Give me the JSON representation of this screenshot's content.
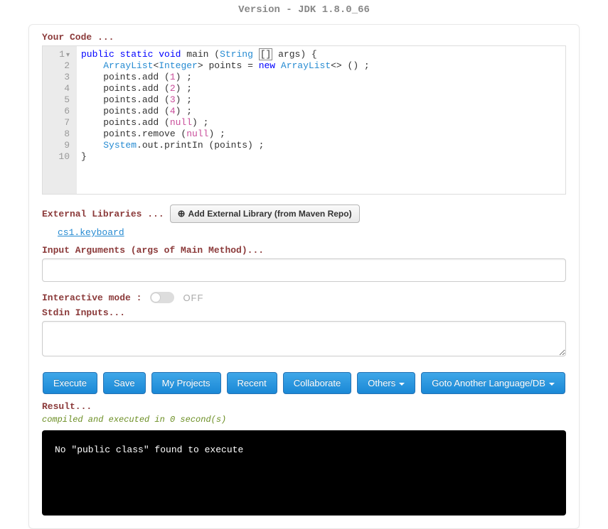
{
  "version_header": "Version - JDK 1.8.0_66",
  "labels": {
    "your_code": "Your Code ...",
    "external_libs": "External Libraries ...",
    "input_args": "Input Arguments (args of Main Method)...",
    "interactive_mode": "Interactive mode :",
    "stdin": "Stdin Inputs...",
    "result": "Result..."
  },
  "code": {
    "gutter": [
      "1",
      "2",
      "3",
      "4",
      "5",
      "6",
      "7",
      "8",
      "9",
      "10"
    ],
    "lines": [
      {
        "tokens": [
          {
            "t": "public",
            "c": "k-blue"
          },
          {
            "t": " "
          },
          {
            "t": "static",
            "c": "k-blue"
          },
          {
            "t": " "
          },
          {
            "t": "void",
            "c": "k-blue"
          },
          {
            "t": " main ("
          },
          {
            "t": "String",
            "c": "k-ident"
          },
          {
            "t": " "
          },
          {
            "t": "[]",
            "c": "bracket-box"
          },
          {
            "t": " args) {"
          }
        ]
      },
      {
        "tokens": [
          {
            "t": "    "
          },
          {
            "t": "ArrayList",
            "c": "k-ident"
          },
          {
            "t": "<"
          },
          {
            "t": "Integer",
            "c": "k-ident"
          },
          {
            "t": "> points = "
          },
          {
            "t": "new",
            "c": "k-blue"
          },
          {
            "t": " "
          },
          {
            "t": "ArrayList",
            "c": "k-ident"
          },
          {
            "t": "<> () ;"
          }
        ]
      },
      {
        "tokens": [
          {
            "t": "    points.add ("
          },
          {
            "t": "1",
            "c": "k-num"
          },
          {
            "t": ") ;"
          }
        ]
      },
      {
        "tokens": [
          {
            "t": "    points.add ("
          },
          {
            "t": "2",
            "c": "k-num"
          },
          {
            "t": ") ;"
          }
        ]
      },
      {
        "tokens": [
          {
            "t": "    points.add ("
          },
          {
            "t": "3",
            "c": "k-num"
          },
          {
            "t": ") ;"
          }
        ]
      },
      {
        "tokens": [
          {
            "t": "    points.add ("
          },
          {
            "t": "4",
            "c": "k-num"
          },
          {
            "t": ") ;"
          }
        ]
      },
      {
        "tokens": [
          {
            "t": "    points.add ("
          },
          {
            "t": "null",
            "c": "k-null"
          },
          {
            "t": ") ;"
          }
        ]
      },
      {
        "tokens": [
          {
            "t": "    points.remove ("
          },
          {
            "t": "null",
            "c": "k-null"
          },
          {
            "t": ") ;"
          }
        ]
      },
      {
        "tokens": [
          {
            "t": "    "
          },
          {
            "t": "System",
            "c": "k-ident"
          },
          {
            "t": ".out.printIn (points) ;"
          }
        ]
      },
      {
        "tokens": [
          {
            "t": "}"
          }
        ]
      }
    ]
  },
  "ext_lib_button": "Add External Library (from Maven Repo)",
  "libraries": [
    "cs1.keyboard"
  ],
  "interactive_state": "OFF",
  "buttons": {
    "execute": "Execute",
    "save": "Save",
    "my_projects": "My Projects",
    "recent": "Recent",
    "collaborate": "Collaborate",
    "others": "Others",
    "goto_lang": "Goto Another Language/DB"
  },
  "result_msg": "compiled and executed in 0 second(s)",
  "result_output": "No \"public class\" found to execute"
}
